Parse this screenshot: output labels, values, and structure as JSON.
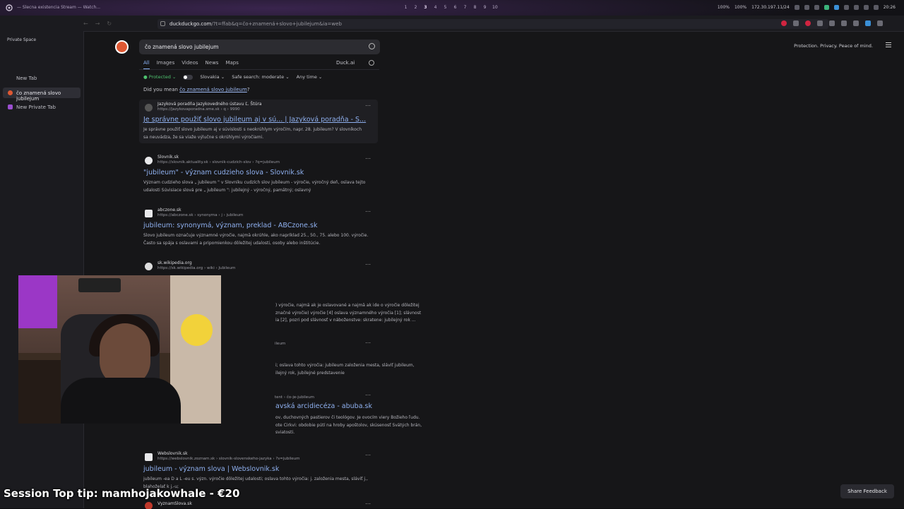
{
  "topbar": {
    "window_title": "— Slecna existencia Stream — Watch...",
    "workspaces": [
      "1",
      "2",
      "3",
      "4",
      "5",
      "6",
      "7",
      "8",
      "9",
      "10"
    ],
    "active_workspace": 3,
    "volume1": "100%",
    "volume2": "100%",
    "ip": "172.30.197.11/24",
    "clock": "20:26"
  },
  "browser": {
    "url_host": "duckduckgo.com",
    "url_rest": "/?t=ffab&q=čo+znamená+slovo+jubilejum&ia=web"
  },
  "sidebar": {
    "space_label": "Private Space",
    "items": [
      {
        "label": "New Tab"
      },
      {
        "label": "čo znamená slovo jubilejum"
      },
      {
        "label": "New Private Tab"
      }
    ]
  },
  "search": {
    "query": "čo znamená slovo jubilejum",
    "tagline": "Protection. Privacy. Peace of mind.",
    "tabs": [
      "All",
      "Images",
      "Videos",
      "News",
      "Maps"
    ],
    "active_tab": "All",
    "duckai": "Duck.ai",
    "filters": {
      "protected": "Protected",
      "region": "Slovakia",
      "safe_search": "Safe search: moderate",
      "time": "Any time"
    },
    "did_you_mean": {
      "prefix": "Did you mean ",
      "suggestion": "čo znamená slovo jubileum",
      "suffix": "?"
    }
  },
  "results": [
    {
      "site": "Jazyková poradňa Jazykovedného ústavu Ľ. Štúra",
      "url": "https://jazykovaporadna.sme.sk › q › 9990",
      "title": "Je správne použiť slovo jubileum aj v sú... | Jazyková poradňa - S...",
      "snippet_1": "Je správne použiť slovo jubileum aj v súvislosti s neokrúhlym výročím, napr. 28. jubileum? V slovníkoch",
      "snippet_2": "sa neuvádza, že sa viaže výlučne s okrúhlymi výročiami."
    },
    {
      "site": "Slovnik.sk",
      "url": "https://slovnik.aktuality.sk › slovnik-cudzich-slov › ?q=jubileum",
      "title": "\"jubileum\" - význam cudzieho slova - Slovnik.sk",
      "snippet_1": "Význam cudzieho slova „ jubileum \" v Slovníku cudzích slov jubileum - výročie, výročný deň, oslava tejto",
      "snippet_2": "udalosti Súvisiace slová pre „ jubileum \": jubilejný - výročný, pamätný; oslavný"
    },
    {
      "site": "abczone.sk",
      "url": "https://abczone.sk › synonyma › j › jubileum",
      "title": "jubileum: synonymá, význam, preklad - ABCzone.sk",
      "snippet_1": "Slovo jubileum označuje významné výročie, najmä okrúhle, ako napríklad 25., 50., 75. alebo 100. výročie.",
      "snippet_2": "Často sa spája s oslavami a pripomienkou dôležitej udalosti, osoby alebo inštitúcie."
    },
    {
      "site": "sk.wikipedia.org",
      "url": "https://sk.wikipedia.org › wiki › Jubileum",
      "snippet_1": ") výročie, najmä ak je oslavované a najmä ak ide o výročie dôležitej",
      "snippet_2": "značné výročie) výročie [4] oslava významného výročia [1]; slávnost",
      "snippet_3": "ia [2], pozri pod slávnosť v náboženstve: skratene: jubilejný rok ..."
    },
    {
      "url": "ileum",
      "snippet_1": "i; oslava tohto výročia: jubileum založenia mesta, sláviť jubileum,",
      "snippet_2": "ilejný rok, jubilejné predstavenie"
    },
    {
      "url": "tent › čo-je-jubileum",
      "title": "avská arcidiecéza - abuba.sk",
      "snippet_1": "ov, duchovných pastierov či teológov. Je ovocím viery Božieho ľudu.",
      "snippet_2": "ote Cirkvi: obdobie pútí na hroby apoštolov, skúsenosť Svätých brán,",
      "snippet_3": "sviatosti."
    },
    {
      "site": "Webslovnik.sk",
      "url": "https://webslovnik.zoznam.sk › slovnik-slovenskeho-jazyka › ?s=jubileum",
      "title": "jubileum - význam slova | Webslovnik.sk",
      "snippet_1": "jubileum -ea D a L -eu s. význ. výročie dôležitej udalosti; oslava tohto výročia: j. založenia mesta, sláviť j.,",
      "snippet_2": "blahoželať k j.-u;"
    },
    {
      "site": "VyznamSlova.sk"
    }
  ],
  "overlay": {
    "text": "Session Top tip: mamhojakowhale - €20"
  },
  "feedback": {
    "label": "Share Feedback"
  },
  "colors": {
    "link": "#8fb0ef",
    "accent_orange": "#de5833",
    "protected_green": "#4fc26f"
  }
}
